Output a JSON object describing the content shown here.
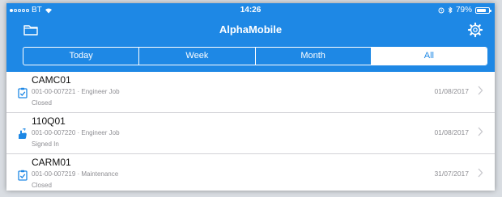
{
  "status_bar": {
    "carrier": "BT",
    "time": "14:26",
    "battery": "79%",
    "battery_level": 0.79
  },
  "nav": {
    "title": "AlphaMobile",
    "left_icon": "folder-icon",
    "right_icon": "gear-icon"
  },
  "segments": {
    "items": [
      "Today",
      "Week",
      "Month",
      "All"
    ],
    "selected": "All"
  },
  "jobs": [
    {
      "title": "CAMC01",
      "subtitle": "001-00-007221 · Engineer Job",
      "status": "Closed",
      "date": "01/08/2017",
      "icon": "clipboard-check-icon"
    },
    {
      "title": "110Q01",
      "subtitle": "001-00-007220 · Engineer Job",
      "status": "Signed In",
      "date": "01/08/2017",
      "icon": "signed-in-hand-icon"
    },
    {
      "title": "CARM01",
      "subtitle": "001-00-007219 · Maintenance",
      "status": "Closed",
      "date": "31/07/2017",
      "icon": "clipboard-check-icon"
    }
  ],
  "colors": {
    "accent": "#1e88e5",
    "background": "#ffffff",
    "secondary_text": "#8e8e93",
    "separator": "#d2d2d6"
  }
}
